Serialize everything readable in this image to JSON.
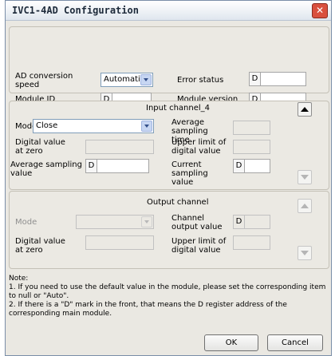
{
  "window": {
    "title": "IVC1-4AD Configuration",
    "close_glyph": "✕"
  },
  "top": {
    "ad_conversion_label": "AD conversion speed",
    "ad_conversion_value": "Automatic",
    "error_status_label": "Error status",
    "module_id_label": "Module ID",
    "module_version_label": "Module version",
    "d_prefix": "D"
  },
  "input": {
    "title": "Input channel_4",
    "mode_label": "Mode",
    "mode_value": "Close",
    "avg_time_label": "Average sampling time",
    "digital_zero_label": "Digital value at zero",
    "upper_limit_label": "Upper limit of digital value",
    "avg_value_label": "Average sampling value",
    "current_value_label": "Current sampling value",
    "d_prefix": "D"
  },
  "output": {
    "title": "Output channel",
    "mode_label": "Mode",
    "channel_output_label": "Channel output value",
    "digital_zero_label": "Digital value at zero",
    "upper_limit_label": "Upper limit of digital value",
    "d_prefix": "D"
  },
  "note": {
    "heading": "Note:",
    "line1": "1. If you need to use the default value in the module, please set the corresponding item to null or \"Auto\".",
    "line2": "2. If there is a \"D\" mark in the front, that means the D register address of the corresponding main module."
  },
  "buttons": {
    "ok": "OK",
    "cancel": "Cancel"
  },
  "icons": {
    "up": "arrow-up-icon",
    "down": "arrow-down-icon",
    "dropdown": "chevron-down-icon",
    "close": "close-icon"
  }
}
